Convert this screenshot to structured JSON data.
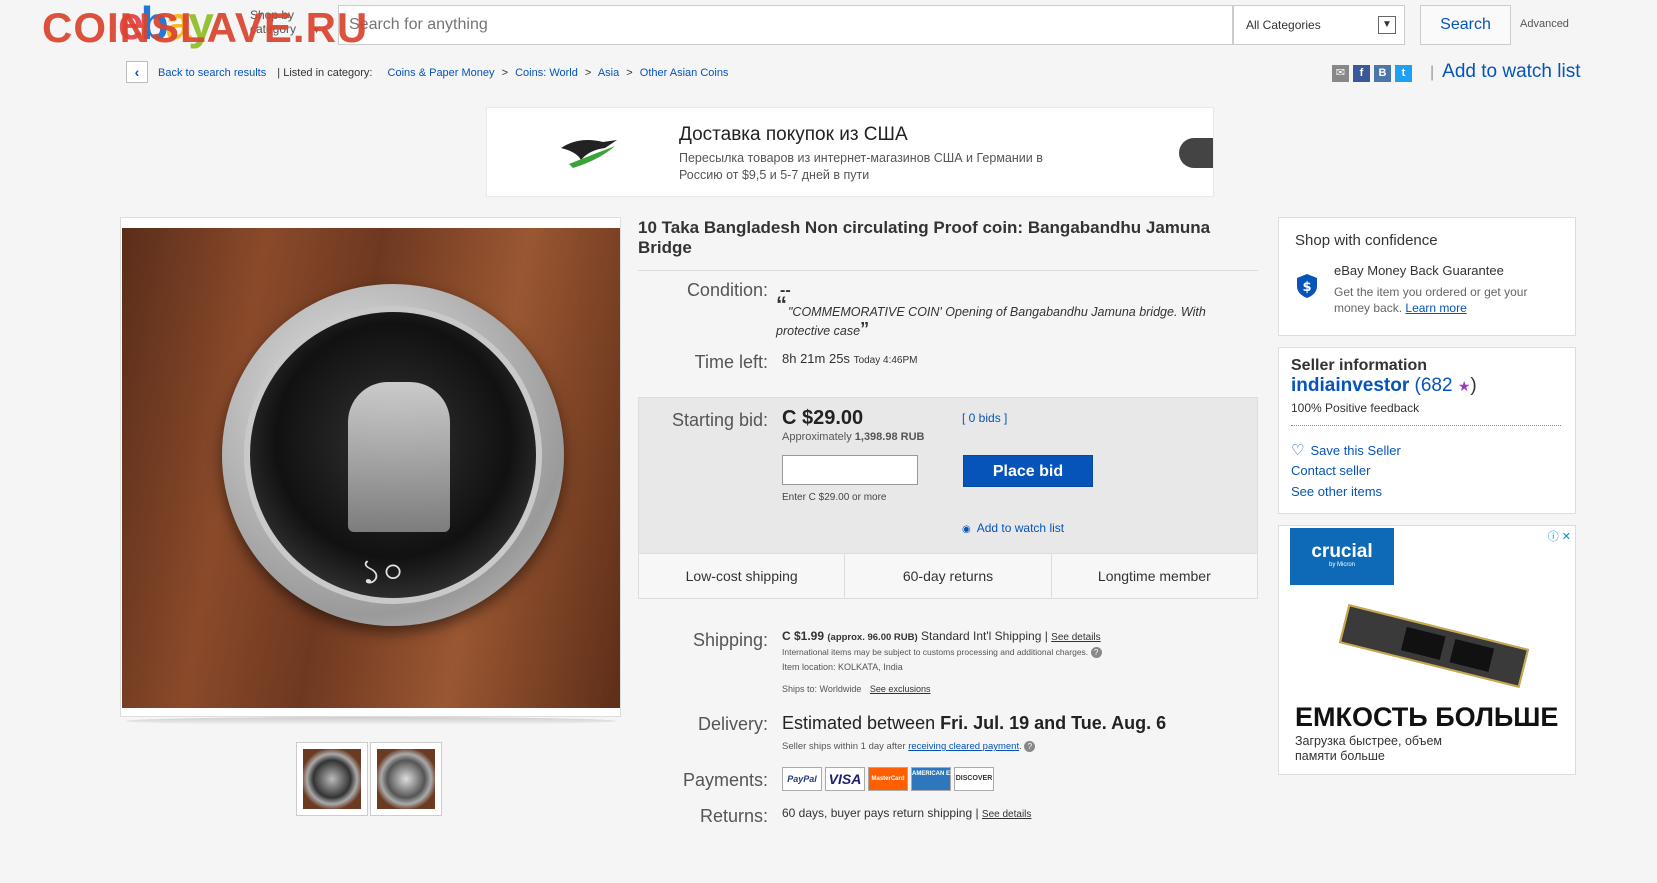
{
  "watermark": "COINSLAVE.RU",
  "header": {
    "logo": [
      "e",
      "b",
      "a",
      "y"
    ],
    "shop_by": "Shop by category",
    "search_placeholder": "Search for anything",
    "category": "All Categories",
    "search_button": "Search",
    "advanced": "Advanced"
  },
  "breadcrumb": {
    "back": "Back to search results",
    "listed": "| Listed in category:",
    "items": [
      "Coins & Paper Money",
      ">",
      "Coins: World",
      ">",
      "Asia",
      ">",
      "Other Asian Coins"
    ],
    "watch": "Add to watch list"
  },
  "share": [
    "✉",
    "f",
    "B",
    "t"
  ],
  "ad": {
    "title": "Доставка покупок из США",
    "text": "Пересылка товаров из интернет-магазинов США и Германии в Россию от $9,5 и 5-7 дней в пути"
  },
  "item": {
    "title": "10 Taka Bangladesh Non circulating Proof coin: Bangabandhu Jamuna Bridge",
    "condition_label": "Condition:",
    "condition_value": "--",
    "condition_quote": "\"COMMEMORATIVE COIN' Opening of Bangabandhu Jamuna bridge. With protective case",
    "time_label": "Time left:",
    "time_value": "8h 21m 25s",
    "time_small": "Today 4:46PM",
    "bid_label": "Starting bid:",
    "price": "C $29.00",
    "bids": "[ 0 bids ]",
    "approx": "Approximately",
    "approx_value": "1,398.98 RUB",
    "enter_hint": "Enter C $29.00 or more",
    "place_bid": "Place bid",
    "watch": "Add to watch list",
    "features": [
      "Low-cost shipping",
      "60-day returns",
      "Longtime member"
    ],
    "shipping_label": "Shipping:",
    "shipping_price": "C $1.99",
    "shipping_approx": "(approx. 96.00 RUB)",
    "shipping_method": "Standard Int'l Shipping |",
    "see_details": "See details",
    "customs": "International items may be subject to customs processing and additional charges.",
    "location_label": "Item location:",
    "location": "KOLKATA, India",
    "ships_to_label": "Ships to:",
    "ships_to": "Worldwide",
    "see_exclusions": "See exclusions",
    "delivery_label": "Delivery:",
    "delivery_prefix": "Estimated between",
    "delivery_dates": "Fri. Jul. 19 and Tue. Aug. 6",
    "handling": "Seller ships within 1 day after",
    "cleared": "receiving cleared payment",
    "payments_label": "Payments:",
    "payments": [
      "PayPal",
      "VISA",
      "MasterCard",
      "AMERICAN EXPRESS",
      "DISCOVER"
    ],
    "returns_label": "Returns:",
    "returns": "60 days, buyer pays return shipping |",
    "returns_details": "See details"
  },
  "confidence": {
    "title": "Shop with confidence",
    "guarantee": "eBay Money Back Guarantee",
    "desc": "Get the item you ordered or get your money back.",
    "learn": "Learn more"
  },
  "seller": {
    "title": "Seller information",
    "name": "indiainvestor",
    "score": "(682",
    "score_close": ")",
    "feedback": "100% Positive feedback",
    "save": "Save this Seller",
    "contact": "Contact seller",
    "other": "See other items"
  },
  "crucial_ad": {
    "brand": "crucial",
    "brand_sub": "by Micron",
    "headline": "ЕМКОСТЬ БОЛЬШЕ",
    "sub": "Загрузка быстрее, объем памяти больше"
  },
  "coin_numeral": "১০",
  "colors": {
    "accent": "#0654ba",
    "watermark": "#d9442e"
  }
}
